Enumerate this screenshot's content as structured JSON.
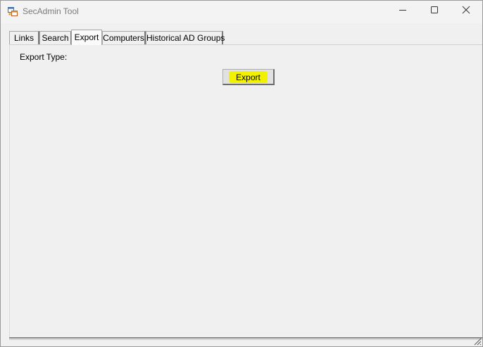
{
  "window": {
    "title": "SecAdmin Tool",
    "app_icon": "app-window-icon",
    "controls": {
      "minimize_icon": "minimize-icon",
      "maximize_icon": "maximize-icon",
      "close_icon": "close-icon"
    }
  },
  "tabs": [
    {
      "label": "Links",
      "active": false
    },
    {
      "label": "Search",
      "active": false
    },
    {
      "label": "Export",
      "active": true
    },
    {
      "label": "Computers",
      "active": false
    },
    {
      "label": "Historical AD Groups",
      "active": false
    }
  ],
  "export_panel": {
    "export_type_label": "Export Type:",
    "export_button_label": "Export"
  },
  "colors": {
    "highlight": "#f2f200",
    "window_bg": "#f0f0f0"
  }
}
